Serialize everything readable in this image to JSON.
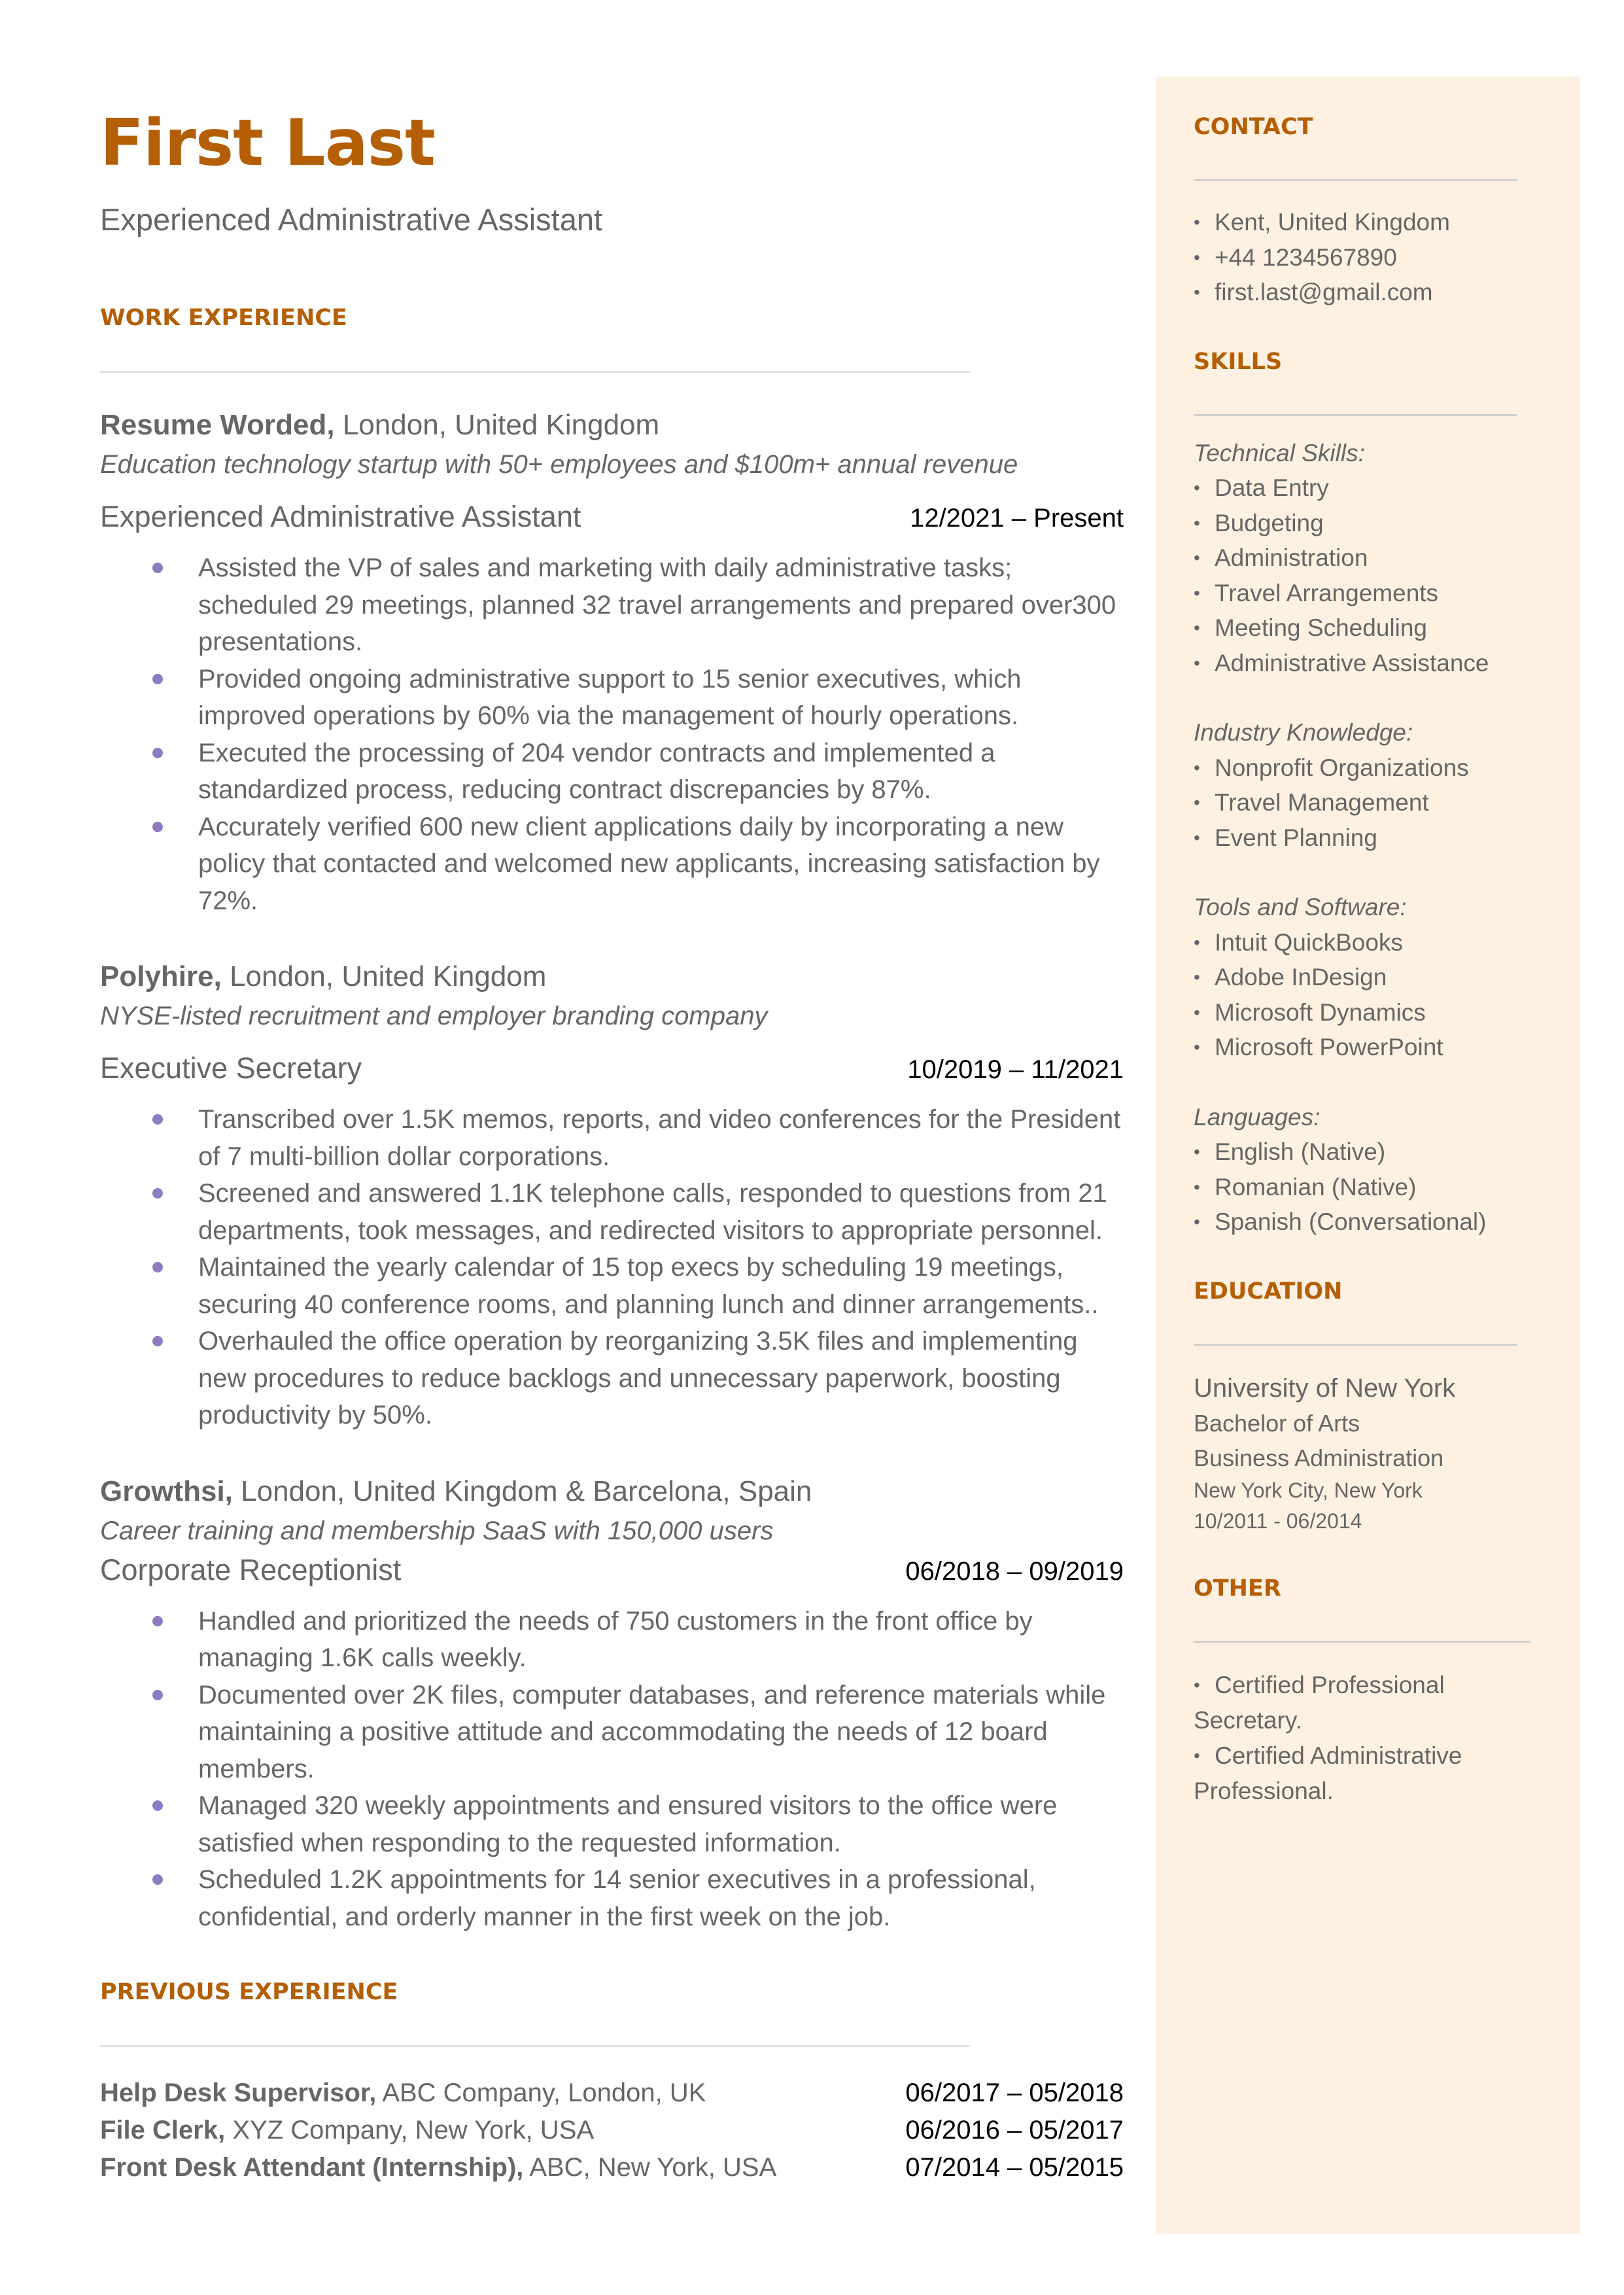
{
  "header": {
    "name": "First Last",
    "title": "Experienced Administrative Assistant"
  },
  "colors": {
    "accent": "#b45f06",
    "bullet": "#8e7cc3",
    "sidebar_bg": "#fef1e2",
    "text": "#666666"
  },
  "work": {
    "title": "WORK EXPERIENCE",
    "jobs": [
      {
        "company": "Resume Worded,",
        "location": " London, United Kingdom",
        "description": "Education technology startup with 50+ employees and $100m+ annual revenue",
        "role": "Experienced Administrative Assistant",
        "dates": "12/2021 – Present",
        "bullets": [
          "Assisted the VP of sales and marketing with daily administrative tasks; scheduled 29 meetings, planned 32 travel arrangements and prepared over300 presentations.",
          "Provided ongoing administrative support to 15 senior executives, which improved operations by 60% via the management of hourly operations.",
          "Executed the processing of 204 vendor contracts and implemented a standardized process, reducing contract discrepancies by 87%.",
          "Accurately verified 600 new client applications daily by incorporating a new policy that contacted and welcomed new applicants, increasing satisfaction by 72%."
        ]
      },
      {
        "company": "Polyhire,",
        "location": " London, United Kingdom",
        "description": "NYSE-listed recruitment and employer branding company",
        "role": "Executive Secretary",
        "dates": "10/2019 – 11/2021",
        "bullets": [
          "Transcribed over 1.5K memos, reports, and video conferences for the President of 7 multi-billion dollar corporations.",
          "Screened and answered 1.1K telephone calls, responded to questions from 21 departments, took messages, and redirected visitors to appropriate personnel.",
          "Maintained the yearly calendar of 15 top execs by scheduling 19 meetings, securing 40 conference rooms, and planning lunch and dinner arrangements..",
          "Overhauled the office operation by reorganizing 3.5K files and implementing new procedures to reduce backlogs and unnecessary paperwork, boosting productivity by 50%."
        ]
      },
      {
        "company": "Growthsi,",
        "location": " London, United Kingdom & Barcelona, Spain",
        "description": "Career training and membership SaaS with 150,000 users",
        "role": "Corporate Receptionist",
        "dates": "06/2018 – 09/2019",
        "bullets": [
          "Handled and prioritized the needs of 750 customers in the front office by managing 1.6K calls weekly.",
          "Documented over 2K files, computer databases, and reference materials while maintaining a positive attitude and accommodating the needs of 12 board members.",
          "Managed 320 weekly appointments and ensured visitors to the office were satisfied when responding to the requested information.",
          "Scheduled 1.2K appointments for 14 senior executives in a professional, confidential, and orderly manner in the first week on the job."
        ]
      }
    ]
  },
  "previous": {
    "title": "PREVIOUS EXPERIENCE",
    "items": [
      {
        "role": "Help Desk Supervisor,",
        "rest": " ABC Company, London, UK",
        "dates": "06/2017 – 05/2018"
      },
      {
        "role": "File Clerk,",
        "rest": " XYZ Company, New York, USA",
        "dates": "06/2016 – 05/2017"
      },
      {
        "role": "Front Desk Attendant (Internship),",
        "rest": " ABC, New York, USA",
        "dates": "07/2014 – 05/2015"
      }
    ]
  },
  "sidebar": {
    "bullet_glyph": "•",
    "contact": {
      "title": "CONTACT",
      "items": [
        "Kent, United Kingdom",
        "+44 1234567890",
        "first.last@gmail.com"
      ]
    },
    "skills": {
      "title": "SKILLS",
      "categories": [
        {
          "label": "Technical Skills:",
          "items": [
            "Data Entry",
            "Budgeting",
            "Administration",
            "Travel Arrangements",
            "Meeting Scheduling",
            "Administrative Assistance"
          ]
        },
        {
          "label": "Industry Knowledge:",
          "items": [
            "Nonprofit Organizations",
            "Travel Management",
            "Event Planning"
          ]
        },
        {
          "label": "Tools and Software:",
          "items": [
            "Intuit QuickBooks",
            "Adobe InDesign",
            "Microsoft Dynamics",
            "Microsoft PowerPoint"
          ]
        },
        {
          "label": "Languages:",
          "items": [
            "English (Native)",
            "Romanian (Native)",
            "Spanish (Conversational)"
          ]
        }
      ]
    },
    "education": {
      "title": "EDUCATION",
      "school": "University of New York",
      "degree": "Bachelor of Arts",
      "field": "Business Administration",
      "location": "New York City, New York",
      "dates": "10/2011 - 06/2014"
    },
    "other": {
      "title": "OTHER",
      "items": [
        "Certified Professional Secretary.",
        "Certified Administrative Professional."
      ]
    }
  }
}
